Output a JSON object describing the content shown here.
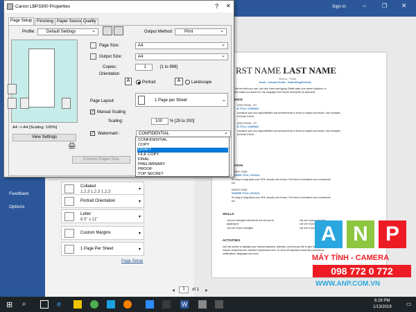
{
  "word": {
    "side_items": [
      "Feedback",
      "Options"
    ],
    "signin": "Sign in",
    "print_settings": [
      {
        "l1": "Collated",
        "l2": "1,2,3   1,2,3   1,2,3"
      },
      {
        "l1": "Portrait Orientation",
        "l2": ""
      },
      {
        "l1": "Letter",
        "l2": "8.5\" x 11\""
      },
      {
        "l1": "Custom Margins",
        "l2": ""
      },
      {
        "l1": "1 Page Per Sheet",
        "l2": ""
      }
    ],
    "page_setup_link": "Page Setup",
    "page_nav": {
      "current": "1",
      "of": "of 1"
    }
  },
  "resume": {
    "name_first": "RST NAME",
    "name_last": "LAST NAME",
    "address": "Address · Phone",
    "contact": "Email · LinkedIn Profile · Twitter/Blog/Portfolio",
    "intro1": "o this text with your own, just click it and start typing. Briefly state your career objective, or",
    "intro2": "what makes you stand out. Use language from the job description as keywords.",
    "exp_heading": "IENCE",
    "exp1_dates": "ATES FROM – TO",
    "exp1_title": "B TITLE, COMPANY",
    "exp1_d1": "ummarize your key responsibilities and achievements in terms of impact and results. Use examples,",
    "exp1_d2": "but keep it short.",
    "exp2_dates": "ATES FROM – TO",
    "exp2_title": "B TITLE, COMPANY",
    "exp2_d1": "ummarize your key responsibilities and achievements in terms of impact and results. Use examples,",
    "exp2_d2": "but keep it short.",
    "edu_heading": "ATION",
    "edu1_date": "MONTH YEAR",
    "edu1_title": "DEGREE TITLE, SCHOOL",
    "edu1_d1": "It's okay to brag about your GPA, awards, and honors. Feel free to summarize your coursework",
    "edu1_d2": "too.",
    "edu2_date": "MONTH YEAR",
    "edu2_title": "DEGREE TITLE, SCHOOL",
    "edu2_d1": "It's okay to brag about your GPA, awards, and honors. Feel free to summarize your coursework",
    "edu2_d2": "too.",
    "skills_heading": "SKILLS",
    "skills": [
      "List your strengths relevant for the role you're",
      "applying for",
      "List one of your strengths",
      "List one of your strengths",
      "List one of your strengths",
      "List one of your strengths"
    ],
    "activities_heading": "ACTIVITIES",
    "act1": "Use this section to highlight your relevant passions, activities, and how you like to give back. It's good to",
    "act2": "include Leadership and volunteer experiences here. Or show off important extras like publications,",
    "act3": "certifications, languages and more."
  },
  "dialog": {
    "title": "Canon LBP3300 Properties",
    "tabs": [
      "Page Setup",
      "Finishing",
      "Paper Source",
      "Quality"
    ],
    "profile_label": "Profile:",
    "profile_value": "Default Settings",
    "output_method_label": "Output Method:",
    "output_method_value": "Print",
    "page_size_label": "Page Size:",
    "page_size_value": "A4",
    "output_size_label": "Output Size:",
    "output_size_value": "A4",
    "copies_label": "Copies:",
    "copies_value": "1",
    "copies_range": "[1 to 999]",
    "orientation_label": "Orientation",
    "portrait": "Portrait",
    "landscape": "Landscape",
    "page_layout_label": "Page Layout:",
    "page_layout_value": "1 Page per Sheet",
    "manual_scaling": "Manual Scaling",
    "scaling_label": "Scaling:",
    "scaling_value": "100",
    "scaling_range": "% [25 to 200]",
    "watermark_label": "Watermark :",
    "watermark_value": "CONFIDENTIAL",
    "watermark_options": [
      "CONFIDENTIAL",
      "COPY",
      "DRAFT",
      "FILE COPY",
      "FINAL",
      "PRELIMINARY",
      "PROOF",
      "TOP SECRET"
    ],
    "watermark_selected": "DRAFT",
    "preview_caption": "A4 -> A4 [Scaling: 100%]",
    "view_settings": "View Settings",
    "custom_paper_size": "Custom Paper Size",
    "close_symbol": "✕",
    "help_symbol": "?"
  },
  "taskbar": {
    "time": "6:28 PM",
    "date": "1/13/2019",
    "lang": "ENG"
  },
  "watermark_brand": {
    "letters": [
      "A",
      "N",
      "P"
    ],
    "line1": "MÁY TÍNH - CAMERA",
    "phone": "098 772 0 772",
    "site": "WWW.ANP.COM.VN",
    "colors": [
      "#2aa7df",
      "#8dc63f",
      "#ed1c24"
    ]
  }
}
